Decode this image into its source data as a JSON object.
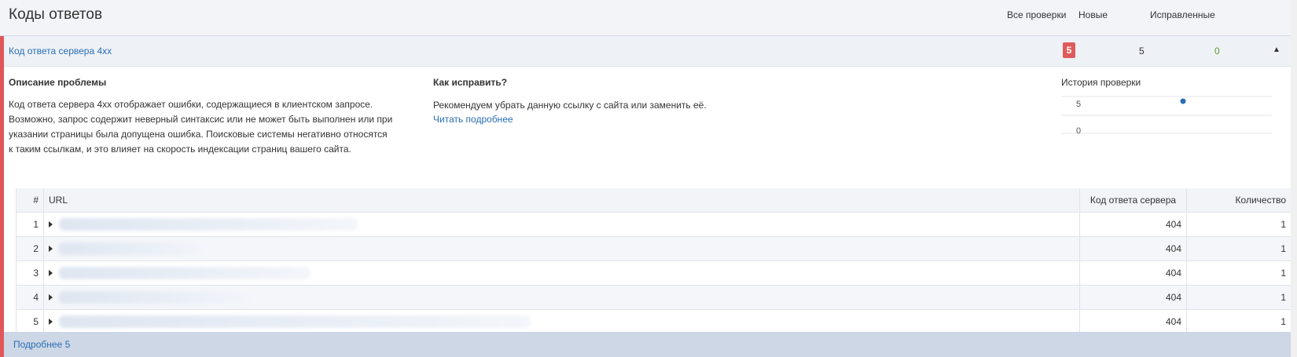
{
  "page": {
    "title": "Коды ответов"
  },
  "columns": {
    "all_checks": "Все проверки",
    "new": "Новые",
    "fixed": "Исправленные"
  },
  "issue": {
    "title": "Код ответа сервера 4xx",
    "all_count": "5",
    "new_count": "5",
    "fixed_count": "0",
    "accent_color": "#df5c5c",
    "fixed_color": "#5aa02c",
    "collapse_icon": "chevron-up-icon"
  },
  "description": {
    "heading": "Описание проблемы",
    "text": "Код ответа сервера 4xx отображает ошибки, содержащиеся в клиентском запросе. Возможно, запрос содержит неверный синтаксис или не может быть выполнен или при указании страницы была допущена ошибка. Поисковые системы негативно относятся к таким ссылкам, и это влияет на скорость индексации страниц вашего сайта."
  },
  "fix": {
    "heading": "Как исправить?",
    "text": "Рекомендуем убрать данную ссылку с сайта или заменить её.",
    "link": "Читать подробнее"
  },
  "history": {
    "heading": "История проверки",
    "y_ticks": [
      "5",
      "0"
    ],
    "points": [
      5
    ]
  },
  "table": {
    "headers": {
      "num": "#",
      "url": "URL",
      "code": "Код ответа сервера",
      "qty": "Количество"
    },
    "rows": [
      {
        "num": "1",
        "code": "404",
        "qty": "1"
      },
      {
        "num": "2",
        "code": "404",
        "qty": "1"
      },
      {
        "num": "3",
        "code": "404",
        "qty": "1"
      },
      {
        "num": "4",
        "code": "404",
        "qty": "1"
      },
      {
        "num": "5",
        "code": "404",
        "qty": "1"
      }
    ]
  },
  "footer": {
    "link": "Подробнее 5"
  }
}
